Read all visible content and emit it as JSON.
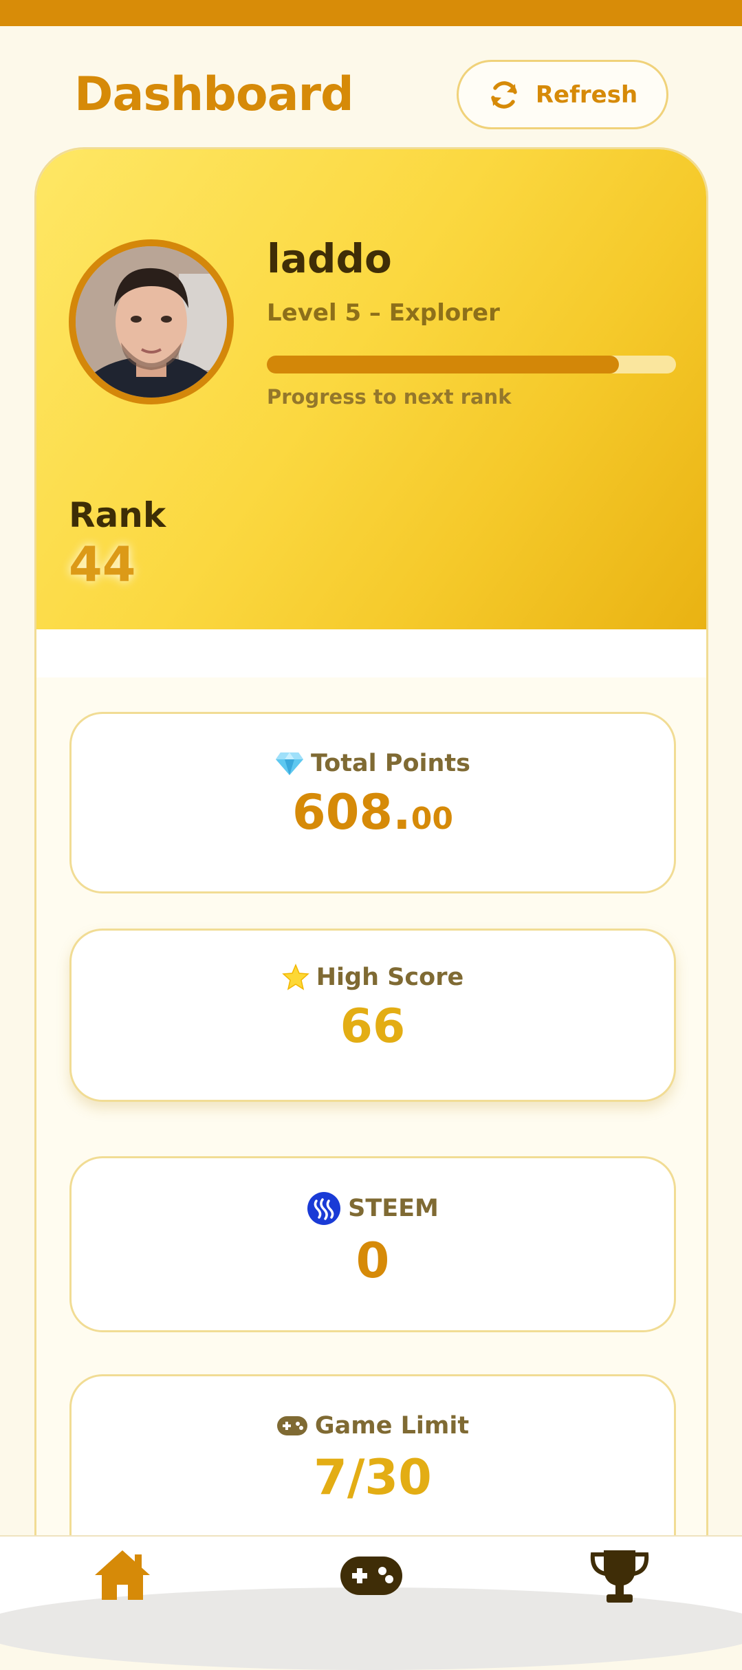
{
  "header": {
    "title": "Dashboard",
    "refresh_label": "Refresh"
  },
  "profile": {
    "username": "laddo",
    "level_text": "Level 5 – Explorer",
    "progress_label": "Progress to next rank",
    "progress_fraction": 0.86,
    "rank_label": "Rank",
    "rank_value": "44"
  },
  "stats": {
    "total_points": {
      "label": "Total Points",
      "whole": "608.",
      "decimals": "00",
      "icon": "gem-icon"
    },
    "high_score": {
      "label": "High Score",
      "value": "66",
      "icon": "star-icon"
    },
    "steem": {
      "label": "STEEM",
      "value": "0",
      "icon": "steem-logo-icon"
    },
    "game_limit": {
      "label": "Game Limit",
      "value": "7/30",
      "icon": "gamepad-icon"
    }
  },
  "nav": {
    "items": [
      {
        "icon": "home-icon"
      },
      {
        "icon": "gamepad-icon"
      },
      {
        "icon": "trophy-icon"
      }
    ]
  },
  "colors": {
    "accent": "#d68a08",
    "gold": "#e9b51b",
    "dark": "#3f2d07"
  }
}
